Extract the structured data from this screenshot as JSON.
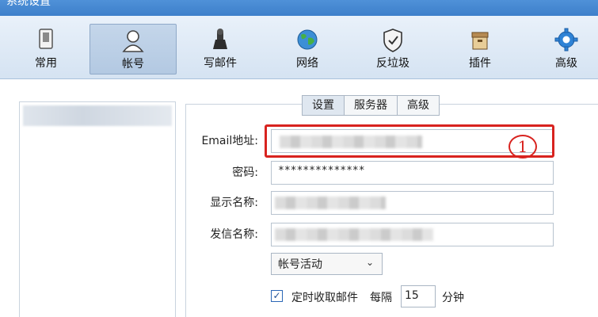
{
  "window": {
    "title": "系统设置"
  },
  "toolbar": {
    "items": [
      {
        "label": "常用",
        "icon": "general-icon"
      },
      {
        "label": "帐号",
        "icon": "account-icon"
      },
      {
        "label": "写邮件",
        "icon": "compose-icon"
      },
      {
        "label": "网络",
        "icon": "globe-icon"
      },
      {
        "label": "反垃圾",
        "icon": "shield-icon"
      },
      {
        "label": "插件",
        "icon": "plugin-box-icon"
      },
      {
        "label": "高级",
        "icon": "gear-icon"
      }
    ],
    "active_index": 1
  },
  "tabs": {
    "settings": "设置",
    "server": "服务器",
    "advanced": "高级"
  },
  "form": {
    "email_label": "Email地址:",
    "password_label": "密码:",
    "password_value": "**************",
    "display_name_label": "显示名称:",
    "sender_name_label": "发信名称:",
    "account_select_value": "帐号活动",
    "auto_fetch_label": "定时收取邮件",
    "auto_fetch_checked": true,
    "every_label": "每隔",
    "interval_value": "15",
    "minutes_label": "分钟"
  },
  "annotation": {
    "number": "1"
  },
  "colors": {
    "accent": "#2b67b6",
    "highlight": "#d8231f",
    "titlebar": "#4f91d8"
  }
}
